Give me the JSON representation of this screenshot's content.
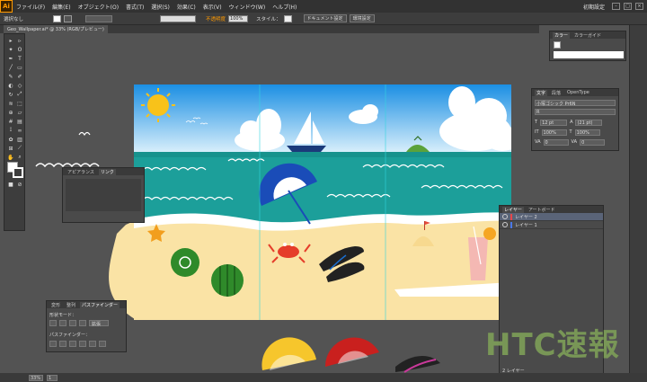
{
  "app": {
    "logo": "Ai"
  },
  "menu": [
    "ファイル(F)",
    "編集(E)",
    "オブジェクト(O)",
    "書式(T)",
    "選択(S)",
    "効果(C)",
    "表示(V)",
    "ウィンドウ(W)",
    "ヘルプ(H)"
  ],
  "menu_right": {
    "workspace": "初期設定"
  },
  "control": {
    "selection_label": "選択なし",
    "opacity_link": "不透明度",
    "opacity_value": "100%",
    "style_label": "スタイル：",
    "doc_settings_button": "ドキュメント設定",
    "preferences_button": "環境設定"
  },
  "document_tab": {
    "title": "Geo_Wallpaper.ai* @ 33% (RGB/プレビュー)"
  },
  "panels": {
    "color": {
      "tab1": "カラー",
      "tab2": "カラーガイド"
    },
    "character": {
      "tab1": "文字",
      "tab2": "段落",
      "tab3": "OpenType",
      "font": "小塚ゴシック Pr6N",
      "style": "R",
      "size": "12 pt",
      "leading": "(21 pt)",
      "scale_v": "100%",
      "scale_h": "100%",
      "tracking": "0",
      "kerning": "0"
    },
    "appearance": {
      "tab1": "アピアランス",
      "tab2": "リンク"
    },
    "layers": {
      "tab1": "レイヤー",
      "tab2": "アートボード",
      "items": [
        {
          "name": "レイヤー 2",
          "color": "#e8464a"
        },
        {
          "name": "レイヤー 1",
          "color": "#4a78e8"
        }
      ],
      "footer": "2 レイヤー"
    },
    "pathfinder": {
      "tab1": "変形",
      "tab2": "整列",
      "tab3": "パスファインダー",
      "shape_mode": "形状モード：",
      "pathfinder_label": "パスファインダー：",
      "expand": "拡張"
    }
  },
  "status": {
    "zoom": "33%",
    "page": "1"
  },
  "watermark": "HTC速報"
}
